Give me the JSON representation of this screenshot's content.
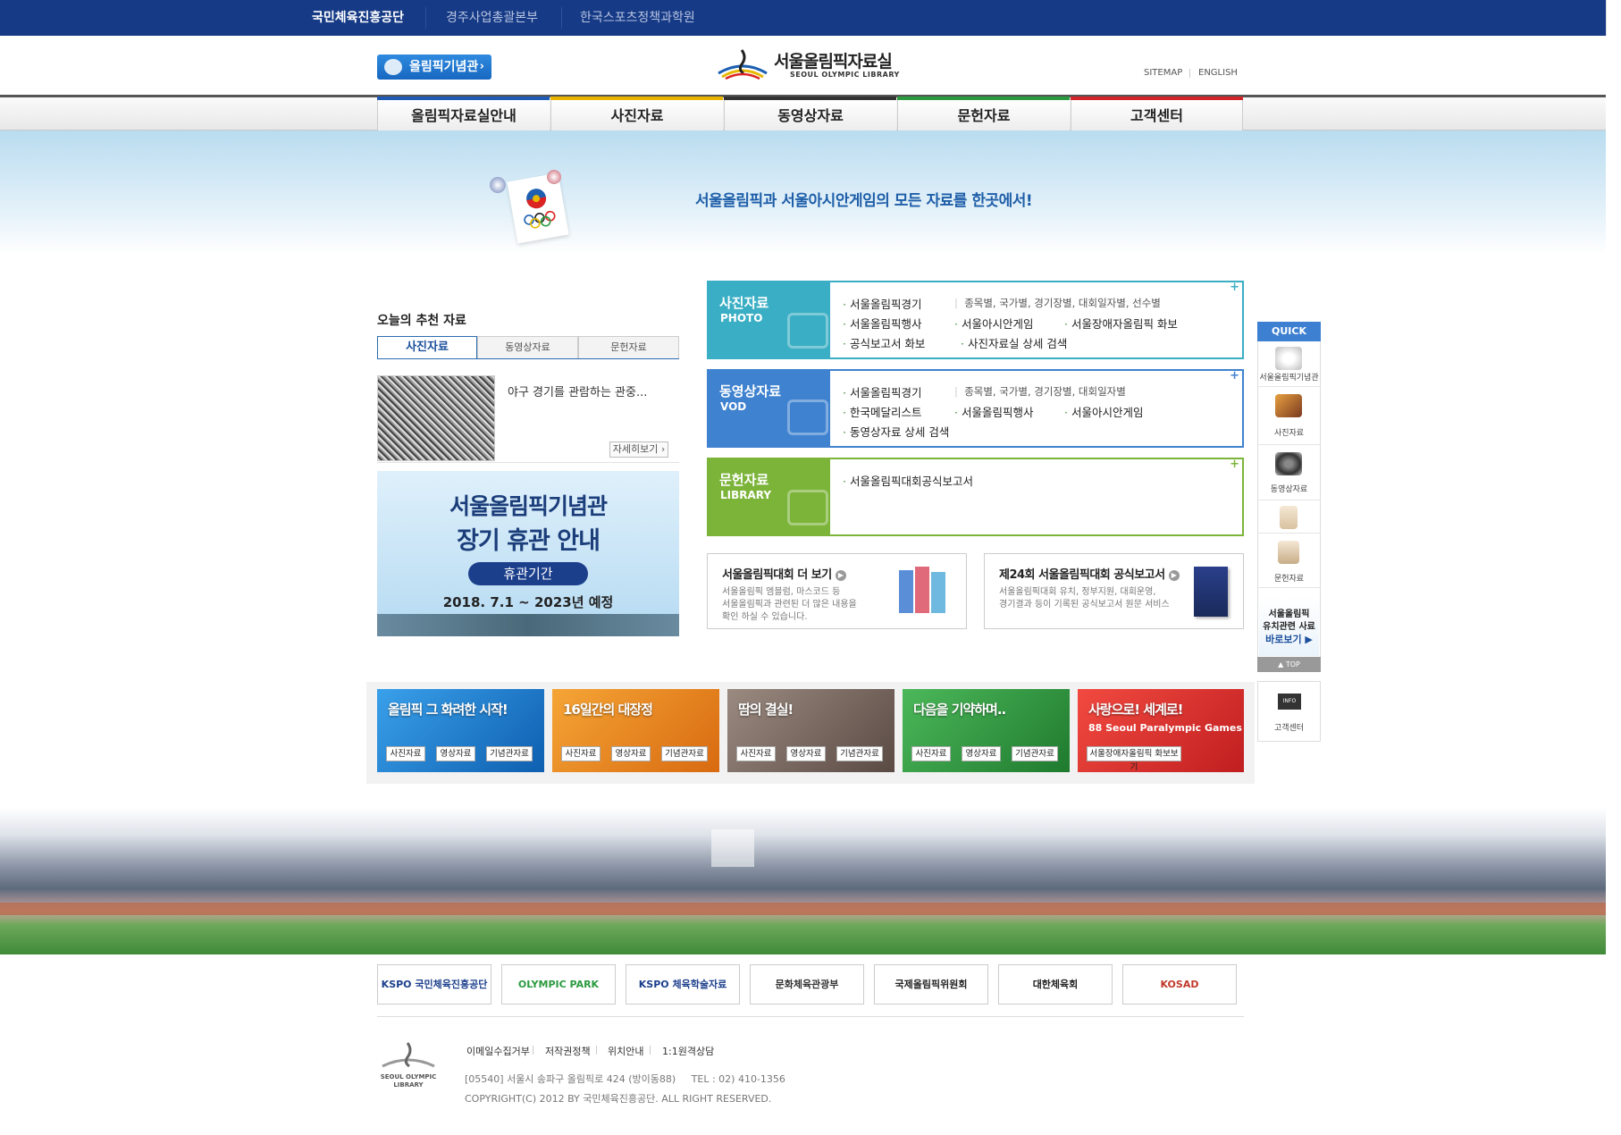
{
  "topbar": {
    "links": [
      "국민체육진흥공단",
      "경주사업총괄본부",
      "한국스포츠정책과학원"
    ]
  },
  "header": {
    "memorial_button": "올림픽기념관",
    "logo_title": "서울올림픽자료실",
    "logo_subtitle": "SEOUL OLYMPIC LIBRARY",
    "util_links": [
      "SITEMAP",
      "ENGLISH"
    ]
  },
  "nav": {
    "items": [
      "올림픽자료실안내",
      "사진자료",
      "동영상자료",
      "문헌자료",
      "고객센터"
    ],
    "accent_colors": [
      "#1f5bb5",
      "#e8b400",
      "#333333",
      "#2b9a3f",
      "#d2252a"
    ]
  },
  "hero": {
    "text": "서울올림픽과 서울아시안게임의 모든 자료를 한곳에서!"
  },
  "recommend": {
    "title": "오늘의 추천 자료",
    "tabs": [
      "사진자료",
      "동영상자료",
      "문헌자료"
    ],
    "item_caption": "야구 경기를 관람하는 관중...",
    "more": "자세히보기"
  },
  "closure_banner": {
    "line1": "서울올림픽기념관",
    "line2": "장기 휴관 안내",
    "pill": "휴관기간",
    "dates": "2018. 7.1 ~ 2023년 예정"
  },
  "categories": [
    {
      "title": "사진자료",
      "eng": "PHOTO",
      "color": "#3aaec4",
      "rows": [
        {
          "main": "서울올림픽경기",
          "sub": "종목별, 국가별, 경기장별, 대회일자별, 선수별"
        },
        {
          "items": [
            "서울올림픽행사",
            "서울아시안게임",
            "서울장애자올림픽 화보"
          ]
        },
        {
          "items": [
            "공식보고서 화보",
            "사진자료실 상세 검색"
          ]
        }
      ]
    },
    {
      "title": "동영상자료",
      "eng": "VOD",
      "color": "#3f82cf",
      "rows": [
        {
          "main": "서울올림픽경기",
          "sub": "종목별, 국가별, 경기장별, 대회일자별"
        },
        {
          "items": [
            "한국메달리스트",
            "서울올림픽행사",
            "서울아시안게임"
          ]
        },
        {
          "items": [
            "동영상자료 상세 검색"
          ]
        }
      ]
    },
    {
      "title": "문헌자료",
      "eng": "LIBRARY",
      "color": "#7cb43a",
      "rows": [
        {
          "items": [
            "서울올림픽대회공식보고서"
          ]
        }
      ]
    }
  ],
  "info_boxes": [
    {
      "title": "서울올림픽대회 더 보기",
      "desc": [
        "서울올림픽 엠블럼, 마스코드 등",
        "서울올림픽과 관련된 더 많은 내용을",
        "확인 하실 수 있습니다."
      ]
    },
    {
      "title": "제24회 서울올림픽대회 공식보고서",
      "desc": [
        "서울올림픽대회 유치, 정부지원, 대회운영,",
        "경기결과 등이 기록된 공식보고서 원문 서비스"
      ]
    }
  ],
  "theme_banners": [
    {
      "title": "올림픽 그 화려한 시작!",
      "sub": "",
      "buttons": [
        "사진자료",
        "영상자료",
        "기념관자료"
      ],
      "color": "#1f8ad6"
    },
    {
      "title": "16일간의 대장정",
      "sub": "",
      "buttons": [
        "사진자료",
        "영상자료",
        "기념관자료"
      ],
      "color": "#ee8a1c"
    },
    {
      "title": "땀의 결실!",
      "sub": "",
      "buttons": [
        "사진자료",
        "영상자료",
        "기념관자료"
      ],
      "color": "#7a6a62"
    },
    {
      "title": "다음을 기약하며..",
      "sub": "",
      "buttons": [
        "사진자료",
        "영상자료",
        "기념관자료"
      ],
      "color": "#2f9a3c"
    },
    {
      "title": "사랑으로! 세계로!",
      "sub": "88 Seoul Paralympic Games",
      "buttons": [
        "서울장애자올림픽 화보보기"
      ],
      "color": "#e0302e"
    }
  ],
  "quick": {
    "title": "QUICK",
    "items": [
      "서울올림픽기념관",
      "사진자료",
      "동영상자료",
      "",
      "문헌자료"
    ],
    "promo": [
      "서울올림픽",
      "유치관련 사료",
      "바로보기"
    ],
    "top": "TOP",
    "info_label": "고객센터",
    "info_icon_text": "INFO"
  },
  "partners": [
    "KSPO 국민체육진흥공단",
    "OLYMPIC PARK",
    "KSPO 체육학술자료",
    "문화체육관광부",
    "국제올림픽위원회",
    "대한체육회",
    "KOSAD"
  ],
  "footer": {
    "links": [
      "이메일수집거부",
      "저작권정책",
      "위치안내",
      "1:1원격상담"
    ],
    "logo_text": [
      "SEOUL OLYMPIC",
      "LIBRARY"
    ],
    "address": "[05540] 서울시 송파구 올림픽로 424 (방이동88)     TEL : 02) 410-1356",
    "copyright": "COPYRIGHT(C) 2012 BY 국민체육진흥공단. ALL RIGHT RESERVED."
  }
}
